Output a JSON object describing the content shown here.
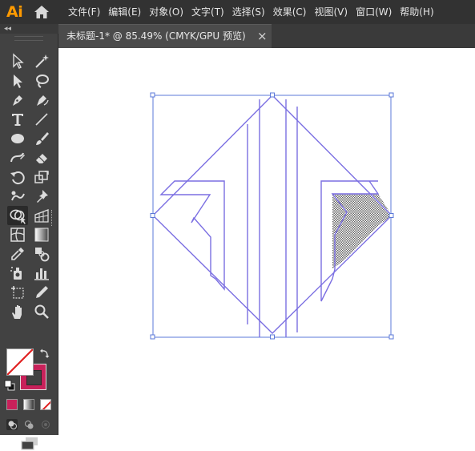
{
  "app": {
    "logo": "Ai"
  },
  "menu": {
    "items": [
      "文件(F)",
      "编辑(E)",
      "对象(O)",
      "文字(T)",
      "选择(S)",
      "效果(C)",
      "视图(V)",
      "窗口(W)",
      "帮助(H)"
    ]
  },
  "toolbar": {
    "collapse": "◂◂",
    "fill_color": "#ffffff",
    "stroke_color": "#c8215a"
  },
  "tab": {
    "label": "未标题-1* @ 85.49% (CMYK/GPU 预览)",
    "close": "×"
  },
  "colors": {
    "menubar_bg": "#323232",
    "panel_bg": "#424242",
    "accent_logo": "#ff9a00",
    "selection_blue": "#4a6fd6",
    "path_stroke": "#7a6fe0"
  }
}
